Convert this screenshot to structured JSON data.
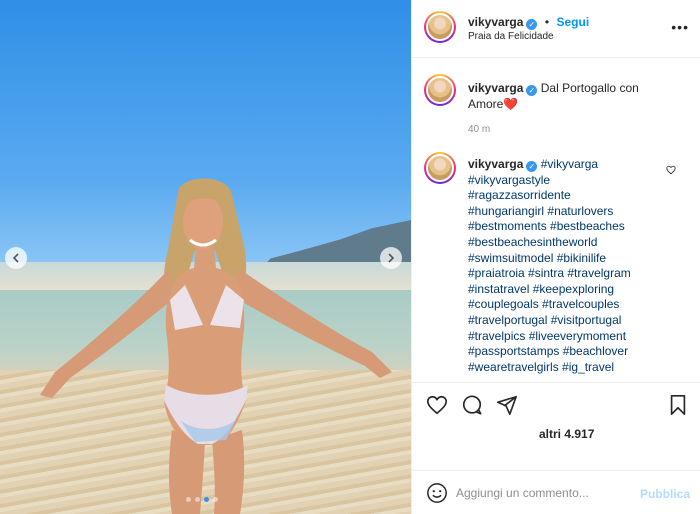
{
  "post": {
    "username": "vikyvarga",
    "follow_label": "Segui",
    "location": "Praia da Felicidade",
    "more_label": "•••",
    "separator": "•"
  },
  "caption": {
    "username": "vikyvarga",
    "text": "Dal Portogallo con Amore",
    "heart_emoji": "❤️",
    "time": "40 m"
  },
  "tags_comment": {
    "username": "vikyvarga",
    "lines": [
      "#vikyvarga",
      "#vikyvargastyle",
      "#ragazzasorridente",
      "#hungariangirl #naturlovers",
      "#bestmoments #bestbeaches",
      "#bestbeachesintheworld",
      "#swimsuitmodel #bikinilife",
      "#praiatroia #sintra #travelgram",
      "#instatravel #keepexploring",
      "#couplegoals #travelcouples",
      "#travelportugal #visitportugal",
      "#travelpics #liveeverymoment",
      "#passportstamps #beachlover",
      "#wearetravelgirls #ig_travel"
    ]
  },
  "likes": {
    "label": "altri 4.917"
  },
  "add_comment": {
    "placeholder": "Aggiungi un commento...",
    "publish_label": "Pubblica"
  },
  "carousel": {
    "total": 4,
    "active_index": 2
  },
  "colors": {
    "accent": "#0095f6",
    "verified": "#3897f0",
    "publish_disabled": "#b3dbff",
    "hashtag": "#00376b"
  },
  "icons": [
    "chevron-left-icon",
    "chevron-right-icon",
    "heart-icon",
    "comment-icon",
    "share-icon",
    "bookmark-icon",
    "smiley-icon",
    "verified-badge-icon",
    "more-options-icon"
  ]
}
